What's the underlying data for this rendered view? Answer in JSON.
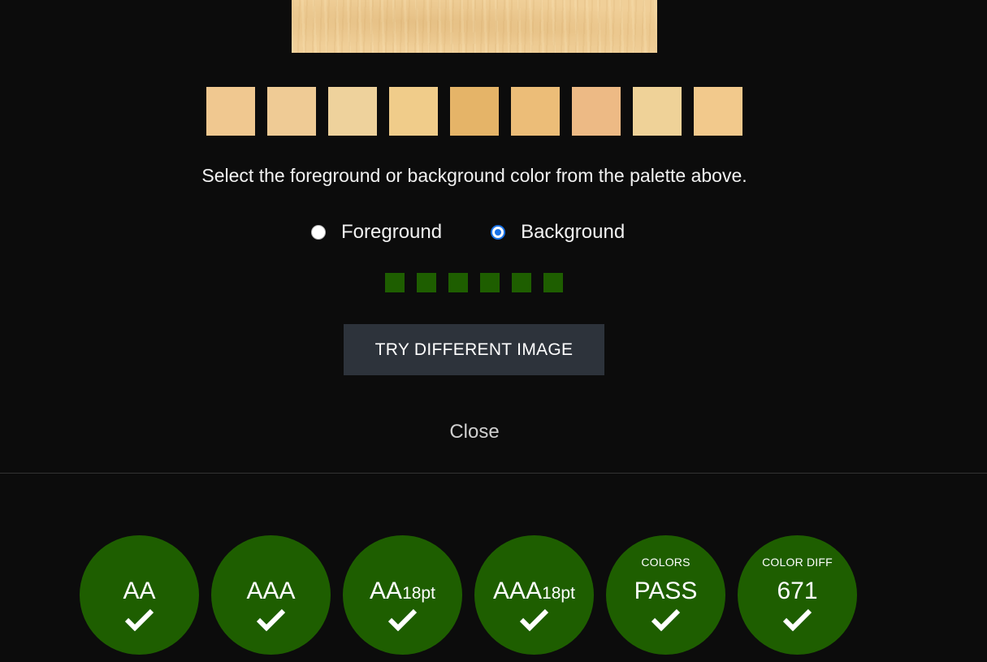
{
  "palette": {
    "swatches": [
      "#f0c890",
      "#efcb95",
      "#eed29c",
      "#f0cc8a",
      "#e5b468",
      "#ecbd78",
      "#edba85",
      "#efd298",
      "#f2c98c"
    ]
  },
  "instruction_text": "Select the foreground or background color from the palette above.",
  "color_mode": {
    "options": [
      {
        "label": "Foreground",
        "checked": false
      },
      {
        "label": "Background",
        "checked": true
      }
    ]
  },
  "progress": {
    "steps_total": 6,
    "steps_complete": 6,
    "color": "#1e5e00"
  },
  "buttons": {
    "try_different_image": "TRY DIFFERENT IMAGE",
    "close": "Close"
  },
  "results": [
    {
      "caption": "",
      "main": "AA",
      "suffix": "",
      "status": "pass"
    },
    {
      "caption": "",
      "main": "AAA",
      "suffix": "",
      "status": "pass"
    },
    {
      "caption": "",
      "main": "AA",
      "suffix": "18pt",
      "status": "pass"
    },
    {
      "caption": "",
      "main": "AAA",
      "suffix": "18pt",
      "status": "pass"
    },
    {
      "caption": "COLORS",
      "main": "PASS",
      "suffix": "",
      "status": "pass"
    },
    {
      "caption": "COLOR DIFF",
      "main": "671",
      "suffix": "",
      "status": "pass"
    }
  ],
  "colors": {
    "pass_green": "#1e5e00",
    "page_background": "#0c0c0c",
    "button_background": "#2d333b",
    "radio_accent": "#1a73e8"
  },
  "icons": {
    "result_check": "checkmark-icon"
  }
}
